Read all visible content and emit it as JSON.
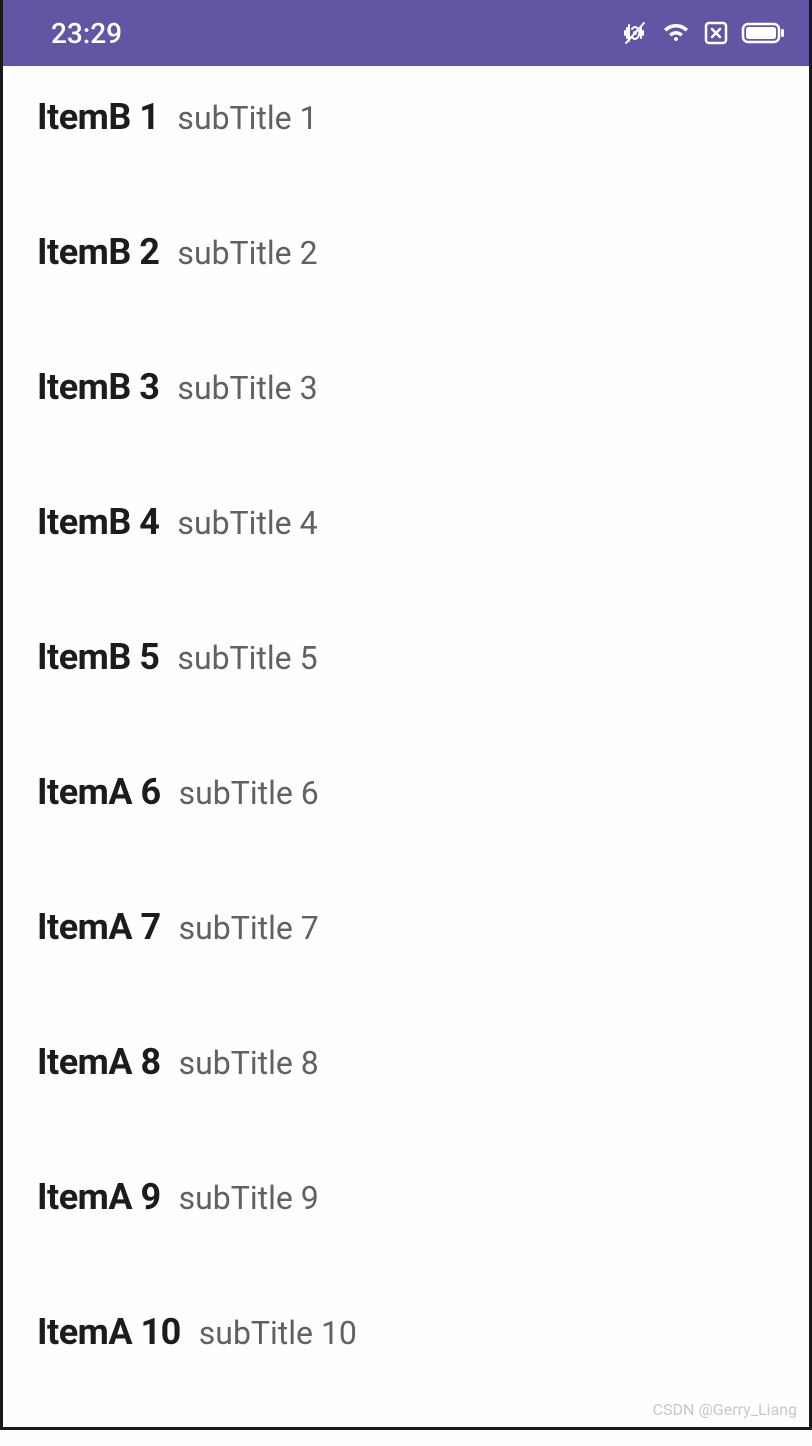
{
  "statusBar": {
    "time": "23:29"
  },
  "list": {
    "items": [
      {
        "title": "ItemB 1",
        "subtitle": "subTitle 1"
      },
      {
        "title": "ItemB 2",
        "subtitle": "subTitle 2"
      },
      {
        "title": "ItemB 3",
        "subtitle": "subTitle 3"
      },
      {
        "title": "ItemB 4",
        "subtitle": "subTitle 4"
      },
      {
        "title": "ItemB 5",
        "subtitle": "subTitle 5"
      },
      {
        "title": "ItemA 6",
        "subtitle": "subTitle 6"
      },
      {
        "title": "ItemA 7",
        "subtitle": "subTitle 7"
      },
      {
        "title": "ItemA 8",
        "subtitle": "subTitle 8"
      },
      {
        "title": "ItemA 9",
        "subtitle": "subTitle 9"
      },
      {
        "title": "ItemA 10",
        "subtitle": "subTitle 10"
      }
    ]
  },
  "watermark": "CSDN @Gerry_Liang"
}
